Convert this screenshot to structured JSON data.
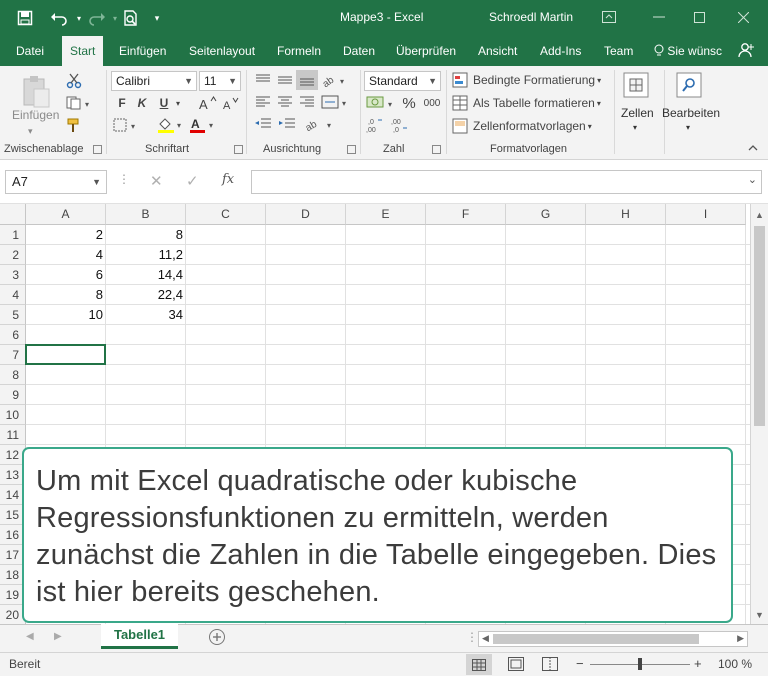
{
  "window": {
    "title": "Mappe3  -  Excel",
    "user": "Schroedl Martin"
  },
  "tabs": [
    "Datei",
    "Start",
    "Einfügen",
    "Seitenlayout",
    "Formeln",
    "Daten",
    "Überprüfen",
    "Ansicht",
    "Add-Ins",
    "Team"
  ],
  "active_tab": "Start",
  "tell_me": "Sie wünsc",
  "ribbon": {
    "clipboard": {
      "paste_label": "Einfügen",
      "group_label": "Zwischenablage"
    },
    "font": {
      "name": "Calibri",
      "size": "11",
      "bold": "F",
      "italic": "K",
      "underline": "U",
      "group_label": "Schriftart"
    },
    "alignment": {
      "group_label": "Ausrichtung"
    },
    "number": {
      "format": "Standard",
      "percent": "%",
      "thousands": "000",
      "group_label": "Zahl"
    },
    "styles": {
      "conditional": "Bedingte Formatierung",
      "as_table": "Als Tabelle formatieren",
      "cell_styles": "Zellenformatvorlagen",
      "group_label": "Formatvorlagen"
    },
    "cells_label": "Zellen",
    "edit_label": "Bearbeiten"
  },
  "formula_bar": {
    "name_box": "A7",
    "fx": "fx",
    "value": ""
  },
  "grid": {
    "columns": [
      "A",
      "B",
      "C",
      "D",
      "E",
      "F",
      "G",
      "H",
      "I"
    ],
    "rows": [
      "1",
      "2",
      "3",
      "4",
      "5",
      "6",
      "7",
      "8",
      "9",
      "10",
      "11",
      "12",
      "13",
      "14",
      "15",
      "16",
      "17",
      "18",
      "19",
      "20"
    ],
    "data": [
      {
        "a": "2",
        "b": "8"
      },
      {
        "a": "4",
        "b": "11,2"
      },
      {
        "a": "6",
        "b": "14,4"
      },
      {
        "a": "8",
        "b": "22,4"
      },
      {
        "a": "10",
        "b": "34"
      }
    ]
  },
  "sheet_tab": "Tabelle1",
  "status": {
    "ready": "Bereit",
    "zoom": "100 %",
    "zoom_level": 0.5
  },
  "caption": "Um mit Excel quadratische oder kubische Regressionsfunktionen zu ermitteln, werden zunächst die Zahlen in die Tabelle eingegeben. Dies ist hier bereits geschehen.",
  "colors": {
    "excel_green": "#217346",
    "caption_border": "#3aa88a"
  }
}
